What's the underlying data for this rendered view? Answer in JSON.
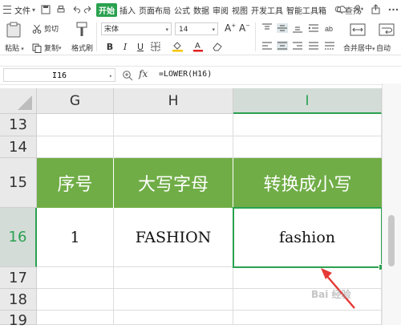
{
  "menu": {
    "file_label": "文件",
    "tabs": [
      "开始",
      "插入",
      "页面布局",
      "公式",
      "数据",
      "审阅",
      "视图",
      "开发工具",
      "智能工具箱"
    ],
    "active_tab": "开始",
    "search_label": "查找"
  },
  "toolbar": {
    "paste_label": "粘贴",
    "cut_label": "剪切",
    "copy_label": "复制",
    "format_painter_label": "格式刷",
    "font_name": "宋体",
    "font_size": "14",
    "bold": "B",
    "italic": "I",
    "underline": "U",
    "merge_label": "合并居中",
    "wrap_label": "自动"
  },
  "formula_bar": {
    "cell_ref": "I16",
    "fx_label": "fx",
    "formula": "=LOWER(H16)"
  },
  "sheet": {
    "columns": [
      "G",
      "H",
      "I"
    ],
    "selected_column": "I",
    "rows": [
      "13",
      "14",
      "15",
      "16",
      "17",
      "18",
      "19"
    ],
    "selected_row": "16",
    "header_row": [
      "序号",
      "大写字母",
      "转换成小写"
    ],
    "data_row": [
      "1",
      "FASHION",
      "fashion"
    ],
    "header_fill": "#70ad47",
    "accent": "#2aa14f"
  },
  "watermark": "Bai 经验"
}
